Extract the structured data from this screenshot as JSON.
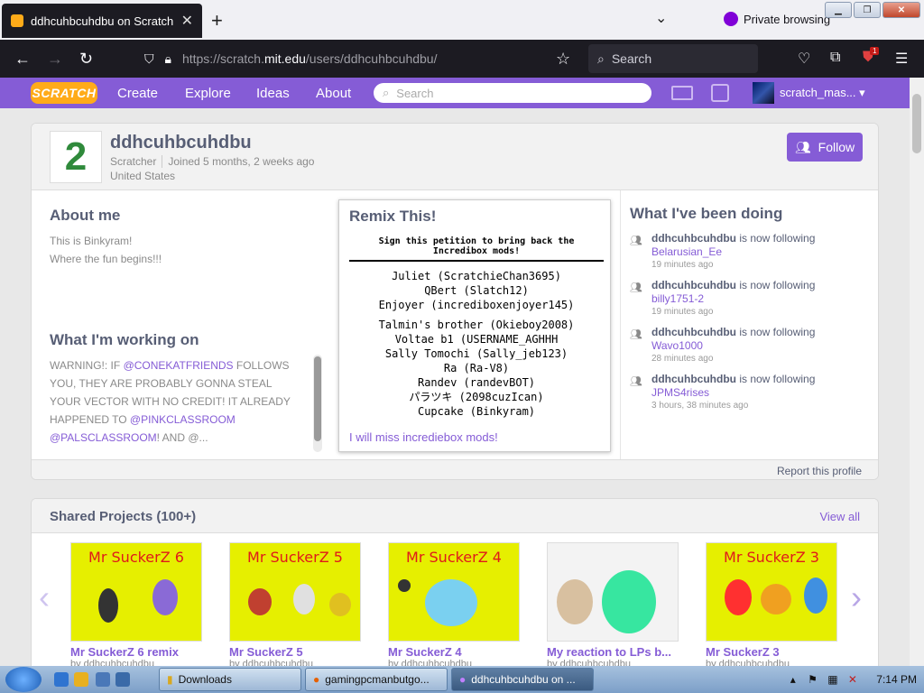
{
  "browser": {
    "tab_title": "ddhcuhbcuhdbu on Scratch",
    "private_label": "Private browsing",
    "url_prefix": "https://scratch.",
    "url_domain": "mit.edu",
    "url_path": "/users/ddhcuhbcuhdbu/",
    "search_placeholder": "Search",
    "ublock_count": "1"
  },
  "scratch_nav": {
    "logo": "SCRATCH",
    "items": [
      "Create",
      "Explore",
      "Ideas",
      "About"
    ],
    "search_placeholder": "Search",
    "username": "scratch_mas..."
  },
  "profile": {
    "username": "ddhcuhbcuhdbu",
    "role": "Scratcher",
    "joined": "Joined 5 months, 2 weeks ago",
    "location": "United States",
    "avatar_glyph": "2",
    "follow_label": "Follow",
    "about_heading": "About me",
    "about_lines": [
      "This is Binkyram!",
      "Where the fun begins!!!"
    ],
    "working_heading": "What I'm working on",
    "working_parts": {
      "p1": "Warning!: If ",
      "m1": "@conekatfriends",
      "p2": " follows you, they are probably gonna steal your vector with no credit! It already happened to ",
      "m2": "@pinkclassroom",
      "m3": "@palsclassroom",
      "p3": "! And @..."
    },
    "report_label": "Report this profile"
  },
  "featured": {
    "heading": "Remix This!",
    "petition": "Sign this petition to bring back the Incredibox mods!",
    "signers_a": [
      "Juliet (ScratchieChan3695)",
      "QBert (Slatch12)",
      "Enjoyer (incrediboxenjoyer145)"
    ],
    "signers_b": [
      "Talmin's brother (Okieboy2008)",
      "Voltae b1 (USERNAME_AGHHH",
      "Sally Tomochi (Sally_jeb123)",
      "Ra (Ra-V8)",
      "Randev (randevBOT)",
      "パラツキ (2098cuzIcan)",
      "Cupcake (Binkyram)"
    ],
    "link": "I will miss incrediebox mods!"
  },
  "activity": {
    "heading": "What I've been doing",
    "verb": "is now following",
    "items": [
      {
        "actor": "ddhcuhbcuhdbu",
        "target": "Belarusian_Ee",
        "time": "19 minutes ago"
      },
      {
        "actor": "ddhcuhbcuhdbu",
        "target": "billy1751-2",
        "time": "19 minutes ago"
      },
      {
        "actor": "ddhcuhbcuhdbu",
        "target": "Wavo1000",
        "time": "28 minutes ago"
      },
      {
        "actor": "ddhcuhbcuhdbu",
        "target": "JPMS4rises",
        "time": "3 hours, 38 minutes ago"
      }
    ]
  },
  "shared": {
    "heading": "Shared Projects (100+)",
    "view_all": "View all",
    "projects": [
      {
        "name": "Mr SuckerZ 6 remix",
        "thumb_title": "Mr SuckerZ 6",
        "by": "by ddhcuhbcuhdbu"
      },
      {
        "name": "Mr SuckerZ 5",
        "thumb_title": "Mr SuckerZ 5",
        "by": "by ddhcuhbcuhdbu"
      },
      {
        "name": "Mr SuckerZ 4",
        "thumb_title": "Mr SuckerZ 4",
        "by": "by ddhcuhbcuhdbu"
      },
      {
        "name": "My reaction to LPs b...",
        "thumb_title": "",
        "by": "by ddhcuhbcuhdbu"
      },
      {
        "name": "Mr SuckerZ 3",
        "thumb_title": "Mr SuckerZ 3",
        "by": "by ddhcuhbcuhdbu"
      }
    ]
  },
  "taskbar": {
    "tasks": [
      "Downloads",
      "gamingpcmanbutgo...",
      "ddhcuhbcuhdbu on ..."
    ],
    "clock": "7:14 PM"
  },
  "colors": {
    "scratch_purple": "#855cd6",
    "scratch_orange": "#ffab19",
    "thumb_yellow": "#e6ef00"
  }
}
